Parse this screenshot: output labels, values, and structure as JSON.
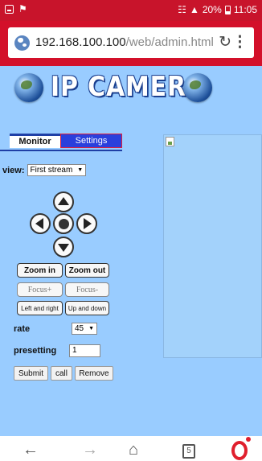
{
  "status_bar": {
    "signal": "☉",
    "battery": "20%",
    "time": "11:05"
  },
  "address_bar": {
    "host": "192.168.100.100",
    "path": "/web/admin.html",
    "reload_icon": "reload-icon",
    "menu_icon": "menu-icon"
  },
  "banner": {
    "title": "IP CAMERA"
  },
  "tabs": {
    "monitor": "Monitor",
    "settings": "Settings"
  },
  "view": {
    "label": "view:",
    "selected": "First stream"
  },
  "ptz": {
    "zoom_in": "Zoom in",
    "zoom_out": "Zoom out",
    "focus_plus": "Focus+",
    "focus_minus": "Focus-",
    "left_right": "Left and right",
    "up_down": "Up and down"
  },
  "rate": {
    "label": "rate",
    "selected": "45"
  },
  "presetting": {
    "label": "presetting",
    "value": "1"
  },
  "actions": {
    "submit": "Submit",
    "call": "call",
    "remove": "Remove"
  },
  "nav": {
    "tabs_count": "5"
  },
  "colors": {
    "status_bar": "#c8142b",
    "page_background": "#99ccff",
    "settings_tab": "#2a3fdc"
  }
}
